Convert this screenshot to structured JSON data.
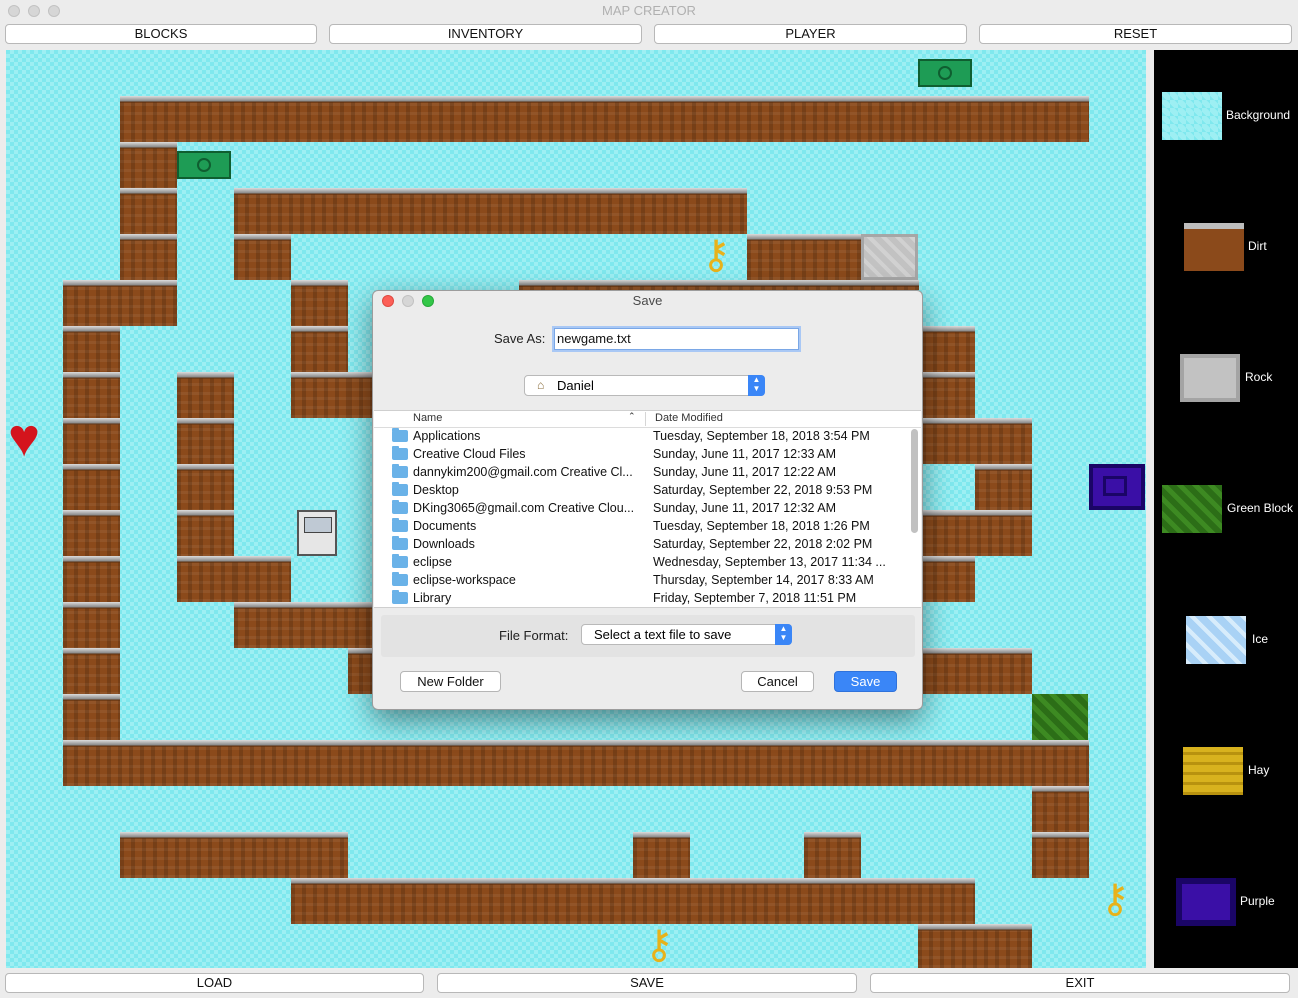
{
  "window": {
    "title": "MAP CREATOR"
  },
  "toolbar": {
    "blocks": "BLOCKS",
    "inventory": "INVENTORY",
    "player": "PLAYER",
    "reset": "RESET"
  },
  "bottombar": {
    "load": "LOAD",
    "save": "SAVE",
    "exit": "EXIT"
  },
  "palette": {
    "items": [
      {
        "label": "Background",
        "icon": "background-tile-icon"
      },
      {
        "label": "Dirt",
        "icon": "dirt-block-icon"
      },
      {
        "label": "Rock",
        "icon": "rock-block-icon"
      },
      {
        "label": "Green Block",
        "icon": "green-block-icon"
      },
      {
        "label": "Ice",
        "icon": "ice-block-icon"
      },
      {
        "label": "Hay",
        "icon": "hay-block-icon"
      },
      {
        "label": "Purple",
        "icon": "purple-block-icon"
      }
    ]
  },
  "dialog": {
    "title": "Save",
    "save_as_label": "Save As:",
    "filename": "newgame.txt",
    "location": "Daniel",
    "columns": {
      "name": "Name",
      "date": "Date Modified"
    },
    "files": [
      {
        "name": "Applications",
        "date": "Tuesday, September 18, 2018 3:54 PM"
      },
      {
        "name": "Creative Cloud Files",
        "date": "Sunday, June 11, 2017 12:33 AM"
      },
      {
        "name": "dannykim200@gmail.com Creative Cl...",
        "date": "Sunday, June 11, 2017 12:22 AM"
      },
      {
        "name": "Desktop",
        "date": "Saturday, September 22, 2018 9:53 PM"
      },
      {
        "name": "DKing3065@gmail.com Creative Clou...",
        "date": "Sunday, June 11, 2017 12:32 AM"
      },
      {
        "name": "Documents",
        "date": "Tuesday, September 18, 2018 1:26 PM"
      },
      {
        "name": "Downloads",
        "date": "Saturday, September 22, 2018 2:02 PM"
      },
      {
        "name": "eclipse",
        "date": "Wednesday, September 13, 2017 11:34 ..."
      },
      {
        "name": "eclipse-workspace",
        "date": "Thursday, September 14, 2017 8:33 AM"
      },
      {
        "name": "Library",
        "date": "Friday, September 7, 2018 11:51 PM"
      }
    ],
    "file_format_label": "File Format:",
    "file_format": "Select a text file to save",
    "new_folder": "New Folder",
    "cancel": "Cancel",
    "save": "Save"
  },
  "colors": {
    "accent": "#3a86f7",
    "background_tile": "#7fe8ee",
    "palette_bg": "#000000",
    "dirt": "#8b4a1b"
  }
}
